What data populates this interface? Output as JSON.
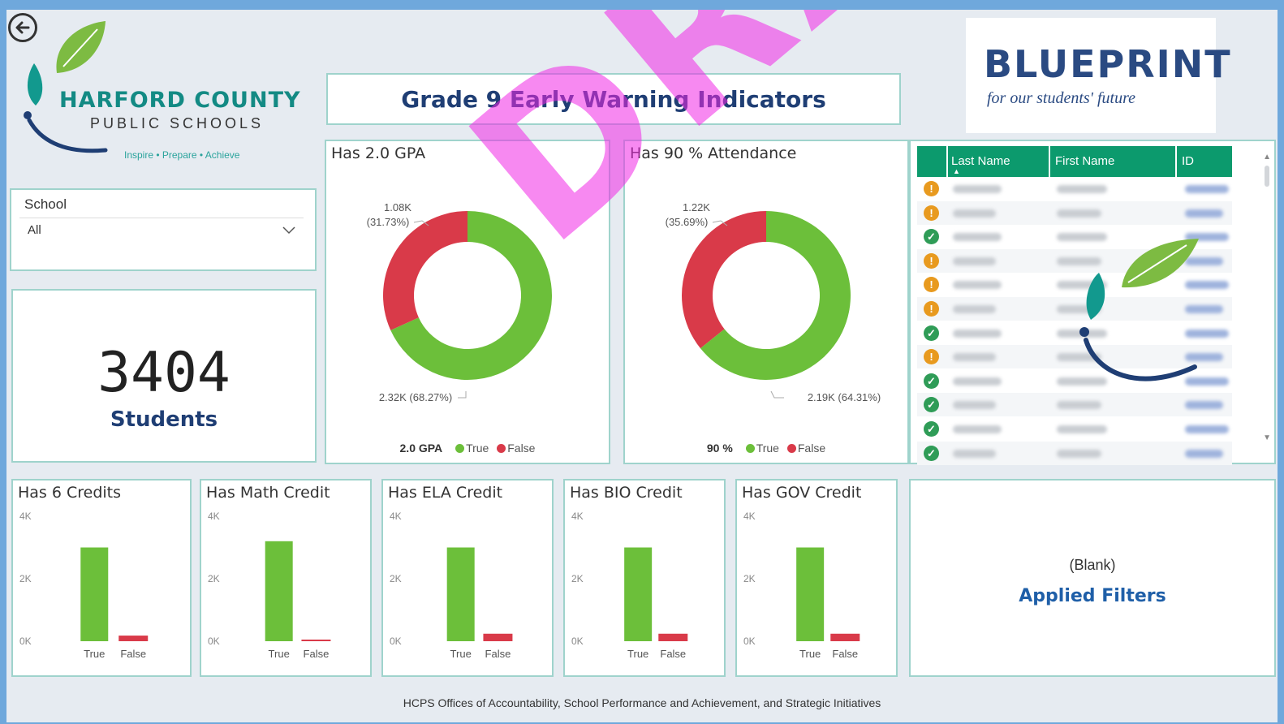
{
  "header": {
    "back_label": "Back",
    "logo": {
      "title": "HARFORD COUNTY",
      "subtitle": "PUBLIC SCHOOLS",
      "tagline": "Inspire • Prepare • Achieve"
    },
    "dashboard_title": "Grade 9 Early Warning Indicators",
    "blueprint": {
      "title": "BLUEPRINT",
      "subtitle": "for our students' future"
    }
  },
  "slicer": {
    "label": "School",
    "value": "All"
  },
  "kpi": {
    "value": "3404",
    "label": "Students"
  },
  "colors": {
    "true": "#6cbf3a",
    "false": "#d93a49",
    "accent": "#0c9a6d",
    "border": "#9fd3cc"
  },
  "chart_data": [
    {
      "type": "pie",
      "title": "Has 2.0 GPA",
      "legend_title": "2.0 GPA",
      "legend": [
        "True",
        "False"
      ],
      "slices": [
        {
          "label": "True",
          "value": 2320,
          "display": "2.32K (68.27%)"
        },
        {
          "label": "False",
          "value": 1080,
          "display": "1.08K (31.73%)"
        }
      ]
    },
    {
      "type": "pie",
      "title": "Has 90 % Attendance",
      "legend_title": "90 %",
      "legend": [
        "True",
        "False"
      ],
      "slices": [
        {
          "label": "True",
          "value": 2190,
          "display": "2.19K (64.31%)"
        },
        {
          "label": "False",
          "value": 1220,
          "display": "1.22K (35.69%)"
        }
      ]
    },
    {
      "type": "bar",
      "title": "Has 6 Credits",
      "categories": [
        "True",
        "False"
      ],
      "values": [
        3000,
        180
      ],
      "yticks": [
        "4K",
        "2K",
        "0K"
      ],
      "ylim": [
        0,
        4000
      ]
    },
    {
      "type": "bar",
      "title": "Has Math Credit",
      "categories": [
        "True",
        "False"
      ],
      "values": [
        3200,
        30
      ],
      "yticks": [
        "4K",
        "2K",
        "0K"
      ],
      "ylim": [
        0,
        4000
      ]
    },
    {
      "type": "bar",
      "title": "Has ELA Credit",
      "categories": [
        "True",
        "False"
      ],
      "values": [
        3000,
        240
      ],
      "yticks": [
        "4K",
        "2K",
        "0K"
      ],
      "ylim": [
        0,
        4000
      ]
    },
    {
      "type": "bar",
      "title": "Has BIO Credit",
      "categories": [
        "True",
        "False"
      ],
      "values": [
        3000,
        240
      ],
      "yticks": [
        "4K",
        "2K",
        "0K"
      ],
      "ylim": [
        0,
        4000
      ]
    },
    {
      "type": "bar",
      "title": "Has GOV Credit",
      "categories": [
        "True",
        "False"
      ],
      "values": [
        3000,
        240
      ],
      "yticks": [
        "4K",
        "2K",
        "0K"
      ],
      "ylim": [
        0,
        4000
      ]
    }
  ],
  "table": {
    "columns": [
      "Last Name",
      "First Name",
      "ID"
    ],
    "status_rows": [
      "warning",
      "warning",
      "ok",
      "warning",
      "warning",
      "warning",
      "ok",
      "warning",
      "ok",
      "ok",
      "ok",
      "ok"
    ]
  },
  "filters": {
    "value": "(Blank)",
    "label": "Applied Filters"
  },
  "footer": "HCPS Offices of Accountability, School Performance and Achievement, and Strategic Initiatives",
  "watermark": "DRAFT"
}
